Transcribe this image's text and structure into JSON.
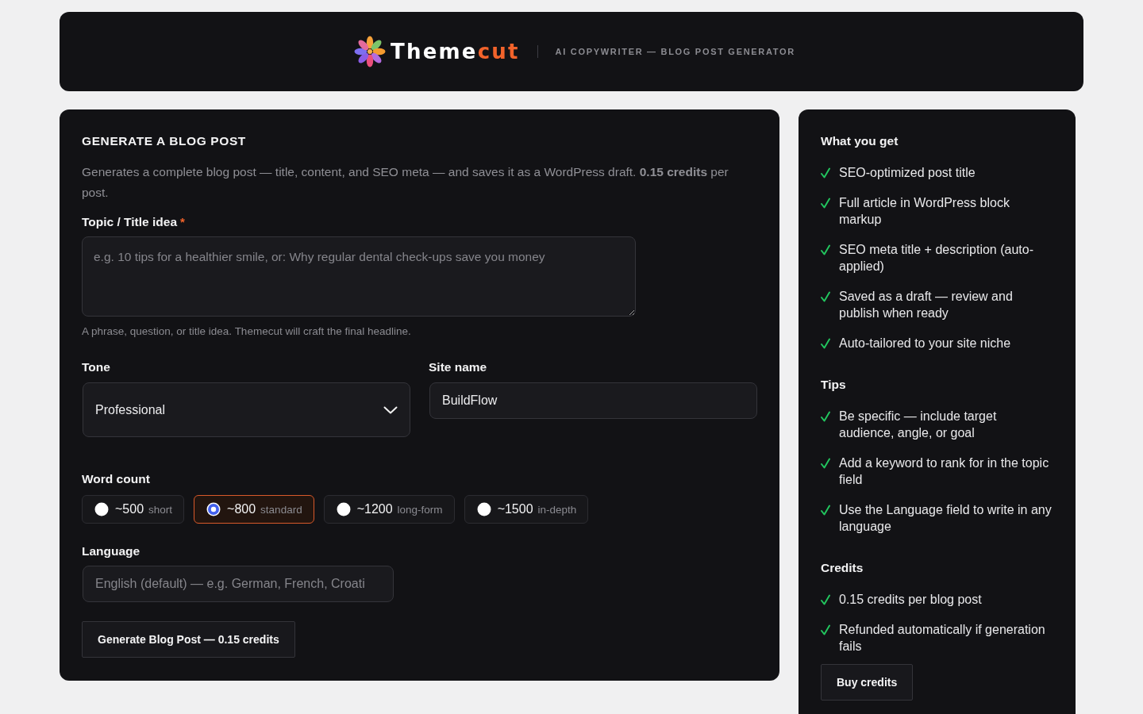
{
  "header": {
    "logo": [
      {
        "text": "Theme",
        "kind": "plain"
      },
      {
        "text": "cut",
        "kind": "accent"
      }
    ],
    "subtitle": "AI COPYWRITER — BLOG POST GENERATOR"
  },
  "form": {
    "title": "GENERATE A BLOG POST",
    "description": "Generates a complete blog post — title, content, and SEO meta — and saves it as a WordPress draft. **0.15 credits** per post.",
    "topic": {
      "label": "Topic / Title idea",
      "required_mark": "*",
      "placeholder": "e.g. 10 tips for a healthier smile, or: Why regular dental check-ups save you money",
      "hint": "A phrase, question, or title idea. Themecut will craft the final headline."
    },
    "tone": {
      "label": "Tone",
      "value": "Professional"
    },
    "site_name": {
      "label": "Site name",
      "value": "BuildFlow"
    },
    "word_count": {
      "label": "Word count",
      "options": [
        {
          "value": "~500",
          "note": "short",
          "selected": false
        },
        {
          "value": "~800",
          "note": "standard",
          "selected": true
        },
        {
          "value": "~1200",
          "note": "long-form",
          "selected": false
        },
        {
          "value": "~1500",
          "note": "in-depth",
          "selected": false
        }
      ]
    },
    "language": {
      "label": "Language",
      "placeholder": "English (default) — e.g. German, French, Croati"
    },
    "submit": "Generate Blog Post — 0.15 credits"
  },
  "sidebar": {
    "sections": [
      {
        "title": "What you get",
        "items": [
          "SEO-optimized post title",
          "Full article in WordPress block markup",
          "SEO meta title + description (auto-applied)",
          "Saved as a draft — review and publish when ready",
          "Auto-tailored to your site niche"
        ]
      },
      {
        "title": "Tips",
        "items": [
          "Be specific — include target audience, angle, or goal",
          "Add a keyword to rank for in the topic field",
          "Use the Language field to write in any language"
        ]
      },
      {
        "title": "Credits",
        "items": [
          "0.15 credits per blog post",
          "Refunded automatically if generation fails"
        ]
      }
    ],
    "button": "Buy credits"
  }
}
